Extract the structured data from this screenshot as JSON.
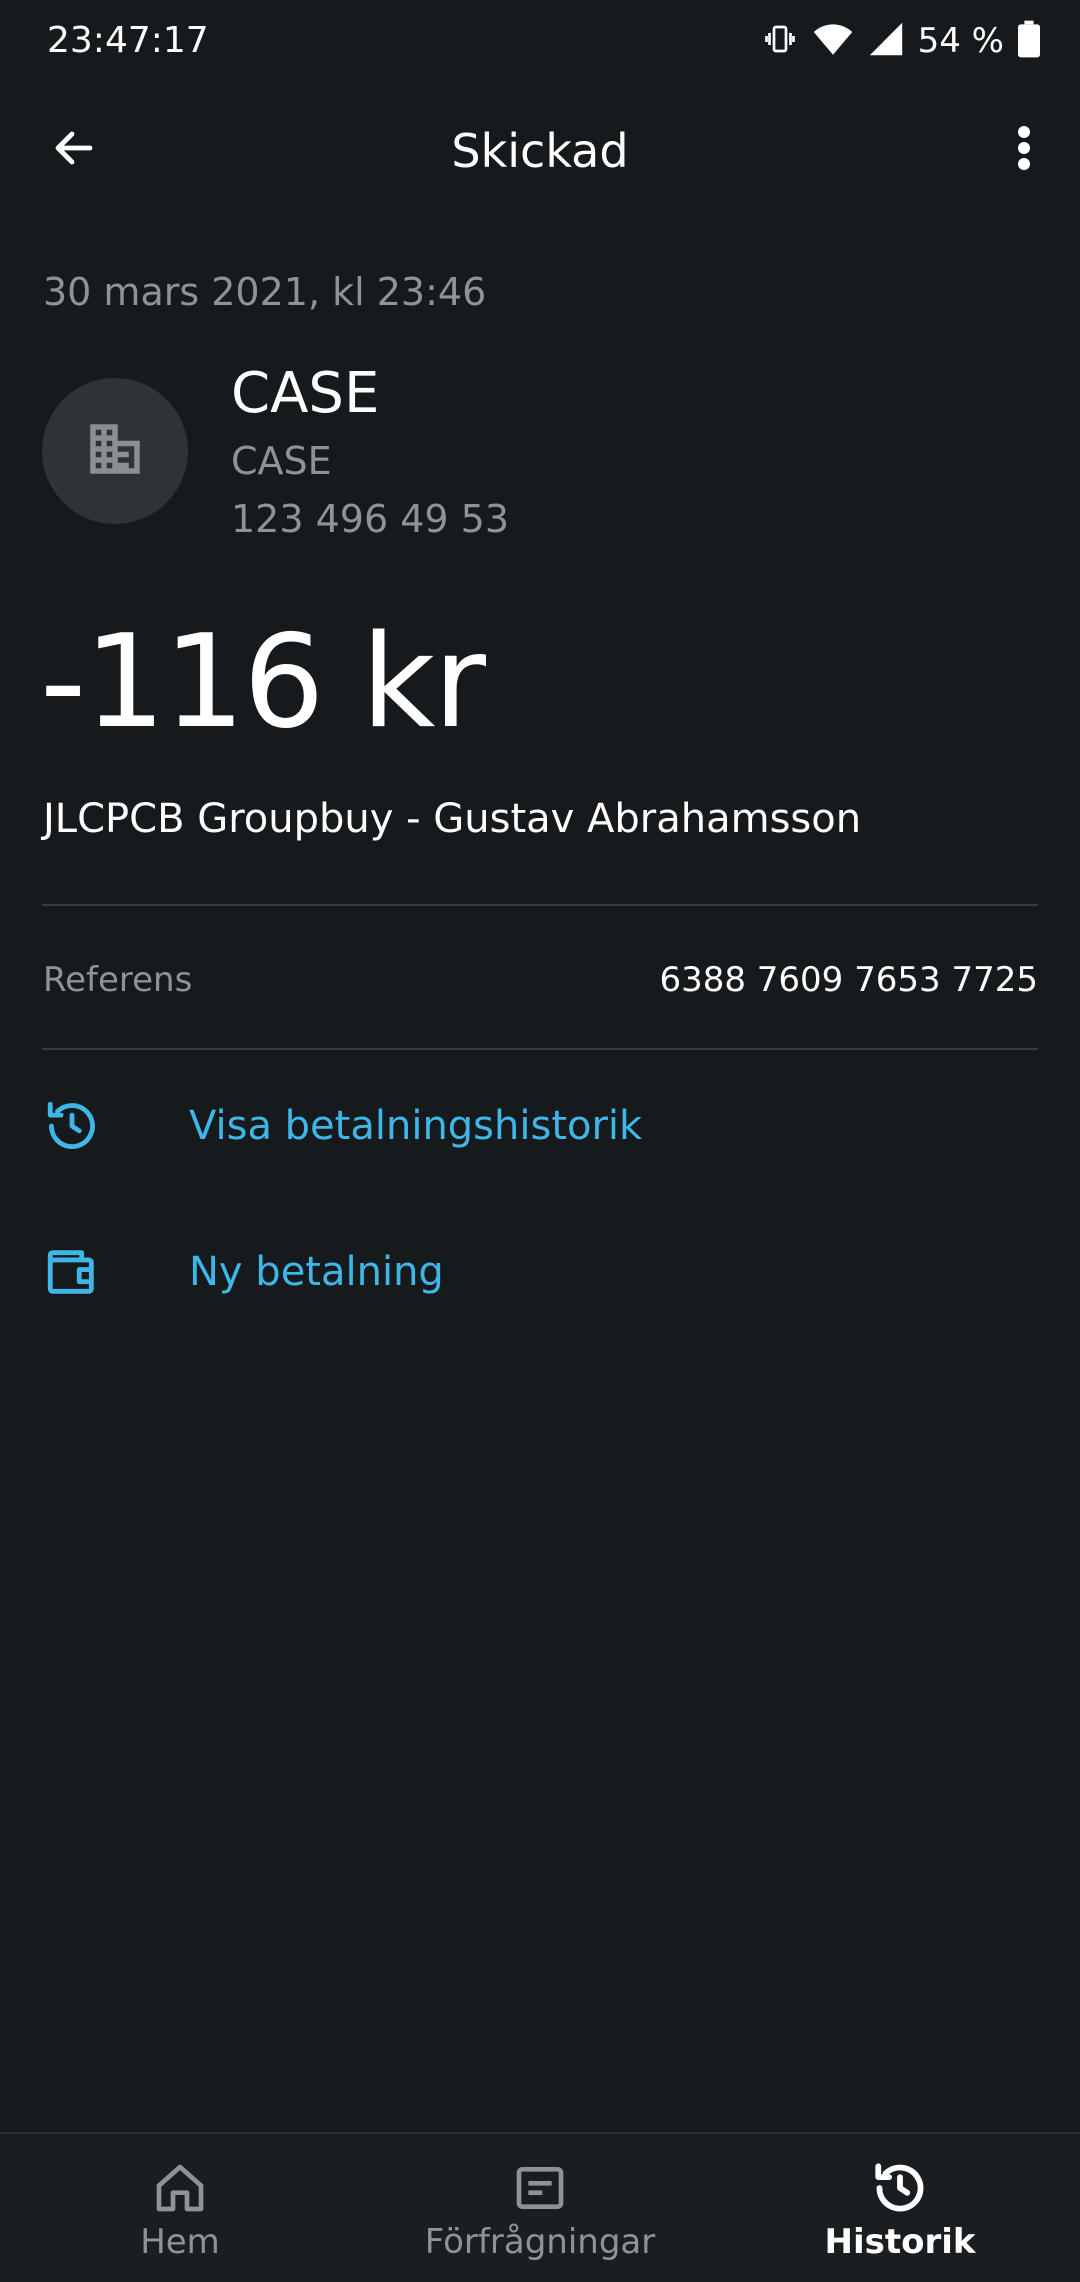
{
  "status_bar": {
    "time": "23:47:17",
    "battery": "54 %",
    "icons": [
      "vibrate-icon",
      "wifi-icon",
      "signal-icon",
      "battery-icon"
    ]
  },
  "app_bar": {
    "title": "Skickad",
    "back_icon": "arrow-left-icon",
    "menu_icon": "more-vert-icon"
  },
  "payment": {
    "date": "30 mars 2021, kl 23:46",
    "recipient_name": "CASE",
    "recipient_sub": "CASE",
    "recipient_number": "123 496 49 53",
    "avatar_icon": "building-icon",
    "amount": "-116 kr",
    "message": "JLCPCB Groupbuy - Gustav Abrahamsson",
    "reference_label": "Referens",
    "reference_value": "6388 7609 7653 7725"
  },
  "actions": [
    {
      "label": "Visa betalningshistorik",
      "icon": "history-icon"
    },
    {
      "label": "Ny betalning",
      "icon": "wallet-icon"
    }
  ],
  "bottom_nav": [
    {
      "label": "Hem",
      "icon": "home-icon",
      "active": false
    },
    {
      "label": "Förfrågningar",
      "icon": "requests-icon",
      "active": false
    },
    {
      "label": "Historik",
      "icon": "history-icon",
      "active": true
    }
  ],
  "colors": {
    "background": "#171a1c",
    "accent": "#3fb6e8",
    "secondary_text": "#8e9396"
  }
}
